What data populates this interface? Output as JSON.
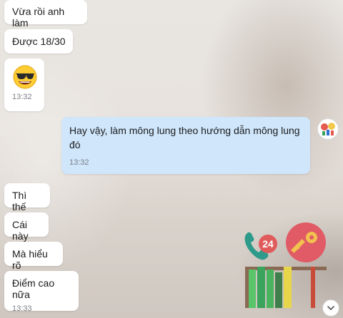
{
  "messages_incoming_top": [
    {
      "text": "Vừa rồi anh làm"
    },
    {
      "text": "Được 18/30"
    }
  ],
  "sticker_message": {
    "emoji": "😎",
    "time": "13:32"
  },
  "outgoing_message": {
    "line1": "Hay vậy, làm mông lung theo hướng dẫn mông lung",
    "line2": "đó",
    "time": "13:32"
  },
  "messages_incoming_bottom": [
    {
      "text": "Thì thế"
    },
    {
      "text": "Cái này"
    },
    {
      "text": "Mà hiểu rõ"
    },
    {
      "text": "Điểm cao nữa",
      "time": "13:33"
    }
  ],
  "overlay_badge": {
    "number": "24"
  },
  "colors": {
    "outgoing_bubble": "#cfe6fb",
    "incoming_bubble": "#ffffff",
    "phone_green": "#2e9b8a",
    "badge_red": "#e05b5b",
    "key_circle": "#e05b66",
    "key_gold": "#f2c14e"
  },
  "icons": {
    "scroll": "chevron-down-icon",
    "phone": "phone-icon",
    "key": "key-icon",
    "books": "bookshelf-icon"
  }
}
